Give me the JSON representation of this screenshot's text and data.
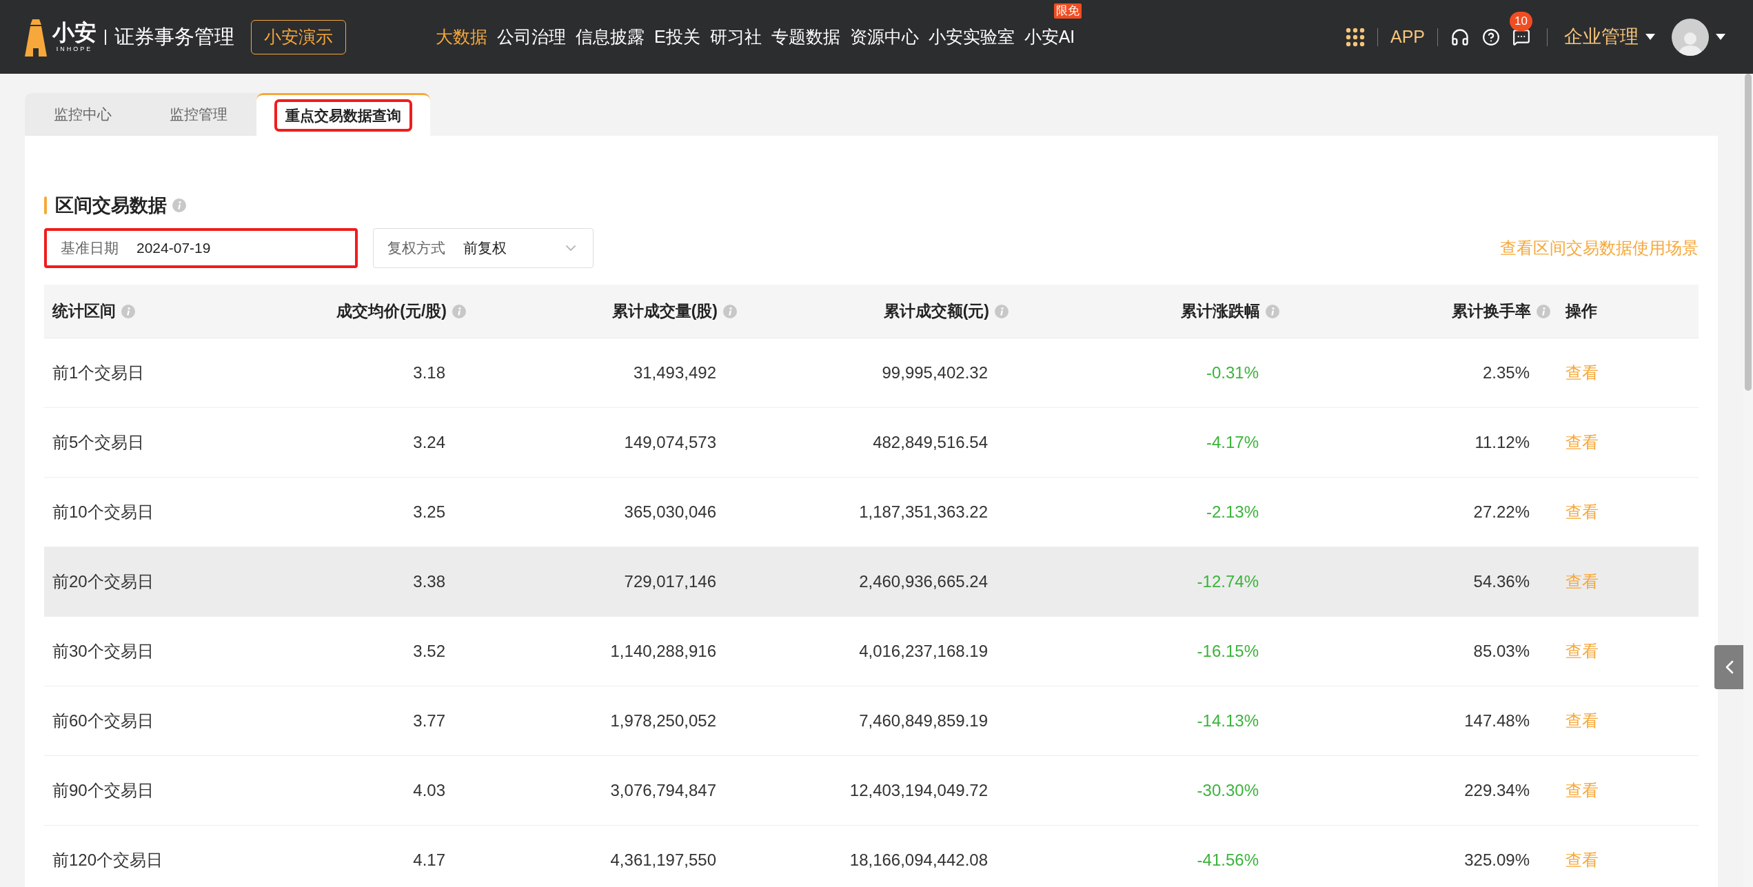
{
  "header": {
    "logo": {
      "mark": "小安",
      "sub": "INHOPE"
    },
    "product": "证券事务管理",
    "demo_button": "小安演示",
    "nav": [
      {
        "label": "大数据",
        "selected": true
      },
      {
        "label": "公司治理",
        "selected": false
      },
      {
        "label": "信息披露",
        "selected": false
      },
      {
        "label": "E投关",
        "selected": false
      },
      {
        "label": "研习社",
        "selected": false
      },
      {
        "label": "专题数据",
        "selected": false
      },
      {
        "label": "资源中心",
        "selected": false
      },
      {
        "label": "小安实验室",
        "selected": false
      },
      {
        "label": "小安AI",
        "selected": false,
        "badge": "限免"
      }
    ],
    "app_link": "APP",
    "message_count": "10",
    "company_menu": "企业管理"
  },
  "tabs": [
    {
      "label": "监控中心",
      "selected": false,
      "annotated": false
    },
    {
      "label": "监控管理",
      "selected": false,
      "annotated": false
    },
    {
      "label": "重点交易数据查询",
      "selected": true,
      "annotated": true
    }
  ],
  "section": {
    "title": "区间交易数据",
    "filters": [
      {
        "kind": "date",
        "label": "基准日期",
        "value": "2024-07-19",
        "annotated": true
      },
      {
        "kind": "select",
        "label": "复权方式",
        "value": "前复权",
        "annotated": false
      }
    ],
    "link": "查看区间交易数据使用场景"
  },
  "table": {
    "columns": [
      {
        "label": "统计区间",
        "info": true
      },
      {
        "label": "成交均价(元/股)",
        "info": true
      },
      {
        "label": "累计成交量(股)",
        "info": true
      },
      {
        "label": "累计成交额(元)",
        "info": true
      },
      {
        "label": "累计涨跌幅",
        "info": true
      },
      {
        "label": "累计换手率",
        "info": true
      },
      {
        "label": "操作",
        "info": false
      }
    ],
    "rows": [
      {
        "period": "前1个交易日",
        "avg_price": "3.18",
        "volume": "31,493,492",
        "amount": "99,995,402.32",
        "change": "-0.31%",
        "turnover": "2.35%",
        "action": "查看",
        "hovered": false
      },
      {
        "period": "前5个交易日",
        "avg_price": "3.24",
        "volume": "149,074,573",
        "amount": "482,849,516.54",
        "change": "-4.17%",
        "turnover": "11.12%",
        "action": "查看",
        "hovered": false
      },
      {
        "period": "前10个交易日",
        "avg_price": "3.25",
        "volume": "365,030,046",
        "amount": "1,187,351,363.22",
        "change": "-2.13%",
        "turnover": "27.22%",
        "action": "查看",
        "hovered": false
      },
      {
        "period": "前20个交易日",
        "avg_price": "3.38",
        "volume": "729,017,146",
        "amount": "2,460,936,665.24",
        "change": "-12.74%",
        "turnover": "54.36%",
        "action": "查看",
        "hovered": true
      },
      {
        "period": "前30个交易日",
        "avg_price": "3.52",
        "volume": "1,140,288,916",
        "amount": "4,016,237,168.19",
        "change": "-16.15%",
        "turnover": "85.03%",
        "action": "查看",
        "hovered": false
      },
      {
        "period": "前60个交易日",
        "avg_price": "3.77",
        "volume": "1,978,250,052",
        "amount": "7,460,849,859.19",
        "change": "-14.13%",
        "turnover": "147.48%",
        "action": "查看",
        "hovered": false
      },
      {
        "period": "前90个交易日",
        "avg_price": "4.03",
        "volume": "3,076,794,847",
        "amount": "12,403,194,049.72",
        "change": "-30.30%",
        "turnover": "229.34%",
        "action": "查看",
        "hovered": false
      },
      {
        "period": "前120个交易日",
        "avg_price": "4.17",
        "volume": "4,361,197,550",
        "amount": "18,166,094,442.08",
        "change": "-41.56%",
        "turnover": "325.09%",
        "action": "查看",
        "hovered": false
      }
    ]
  }
}
